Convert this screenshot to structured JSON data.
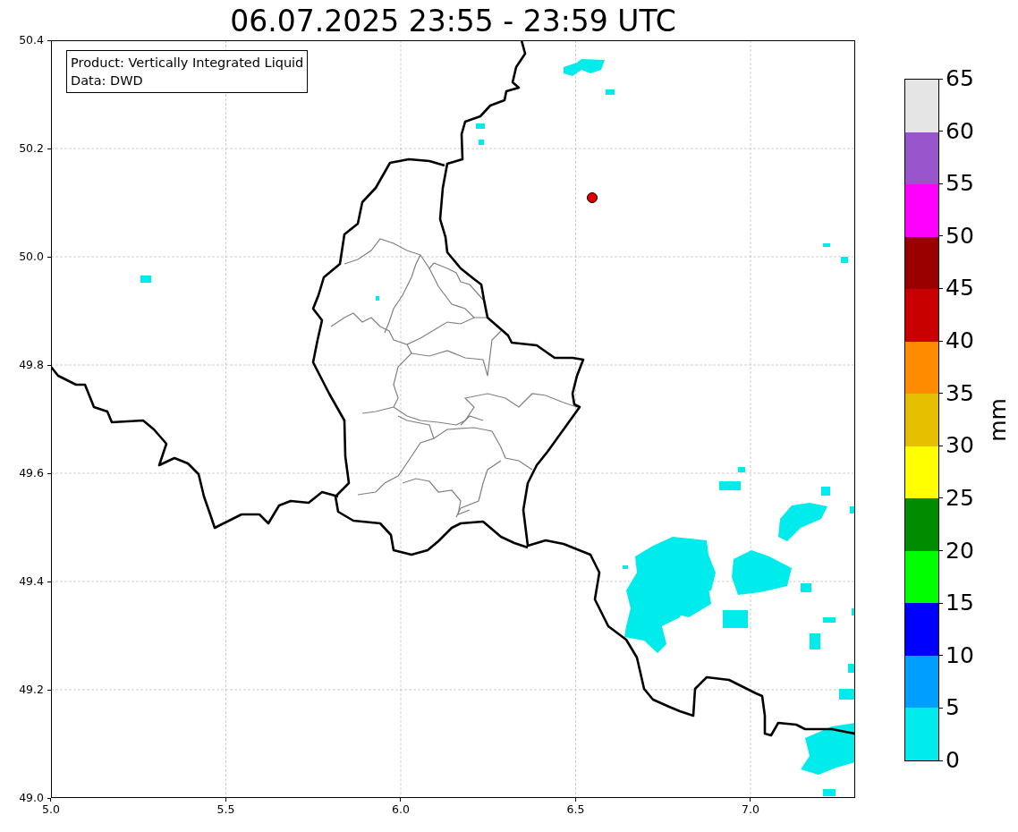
{
  "title": "06.07.2025 23:55 - 23:59 UTC",
  "legend": [
    "Product: Vertically Integrated Liquid",
    "Data: DWD"
  ],
  "x_ticks": [
    "5.0",
    "5.5",
    "6.0",
    "6.5",
    "7.0"
  ],
  "y_ticks": [
    "50.4",
    "50.2",
    "50.0",
    "49.8",
    "49.6",
    "49.4",
    "49.2",
    "49.0"
  ],
  "colorbar": {
    "label": "mm",
    "ticks": [
      "65",
      "60",
      "55",
      "50",
      "45",
      "40",
      "35",
      "30",
      "25",
      "20",
      "15",
      "10",
      "5",
      "0"
    ],
    "bins": [
      {
        "color": "#e5e5e5"
      },
      {
        "color": "#9955cc"
      },
      {
        "color": "#ff00ff"
      },
      {
        "color": "#9a0000"
      },
      {
        "color": "#c80000"
      },
      {
        "color": "#ff8c00"
      },
      {
        "color": "#e6c000"
      },
      {
        "color": "#ffff00"
      },
      {
        "color": "#008c00"
      },
      {
        "color": "#00ff00"
      },
      {
        "color": "#0000ff"
      },
      {
        "color": "#009eff"
      },
      {
        "color": "#00ebeb"
      }
    ]
  }
}
